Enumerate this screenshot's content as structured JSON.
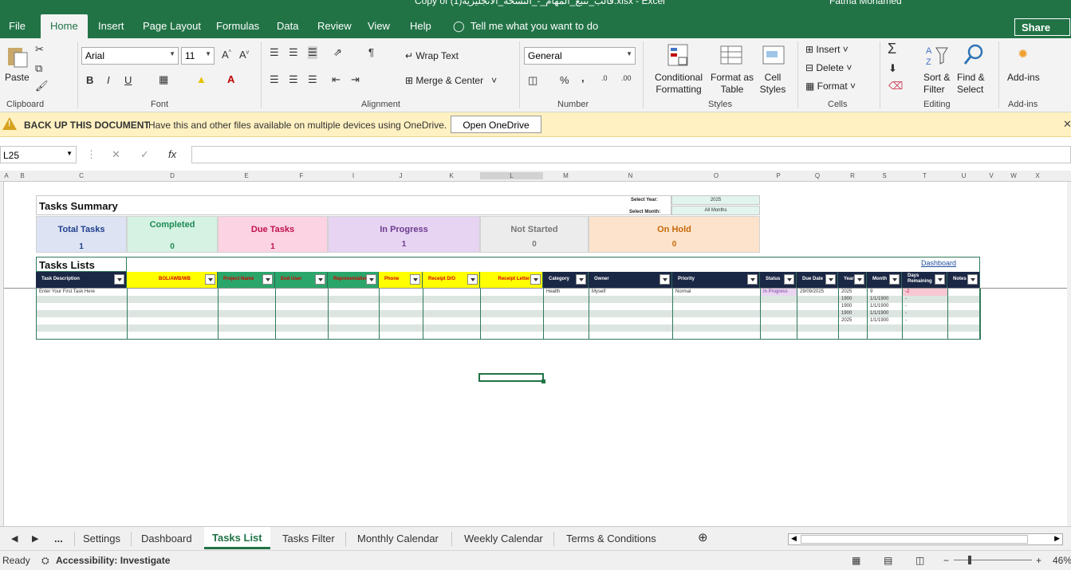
{
  "window": {
    "title": "Copy of (1)قالب_تتبع_المهام_-_النسخة_الانجليزية.xlsx  -  Excel",
    "user": "Fatma Mohamed"
  },
  "ribbon_tabs": [
    "File",
    "Home",
    "Insert",
    "Page Layout",
    "Formulas",
    "Data",
    "Review",
    "View",
    "Help"
  ],
  "tell_me": "Tell me what you want to do",
  "share": "Share",
  "ribbon": {
    "paste": "Paste",
    "font_name": "Arial",
    "font_size": "11",
    "bold": "B",
    "italic": "I",
    "underline": "U",
    "wrap_text": "Wrap Text",
    "merge_center": "Merge & Center",
    "number_format": "General",
    "percent": "%",
    "comma": ",",
    "conditional_formatting": "Conditional Formatting",
    "format_as_table": "Format as Table",
    "cell_styles": "Cell Styles",
    "insert": "Insert",
    "delete": "Delete",
    "format": "Format",
    "sort_filter": "Sort & Filter",
    "find_select": "Find & Select",
    "add_ins": "Add-ins",
    "groups": [
      "Clipboard",
      "Font",
      "Alignment",
      "Number",
      "Styles",
      "Cells",
      "Editing",
      "Add-ins"
    ]
  },
  "message_bar": {
    "title": "BACK UP THIS DOCUMENT",
    "text": "Have this and other files available on multiple devices using OneDrive.",
    "button": "Open OneDrive"
  },
  "formula_bar": {
    "name_box": "L25",
    "fx": "fx",
    "value": ""
  },
  "columns": [
    "A",
    "B",
    "C",
    "D",
    "E",
    "F",
    "I",
    "J",
    "K",
    "L",
    "M",
    "N",
    "O",
    "P",
    "Q",
    "R",
    "S",
    "T",
    "U",
    "V",
    "W",
    "X"
  ],
  "summary": {
    "title": "Tasks Summary",
    "select_year_label": "Select Year:",
    "select_year_value": "2025",
    "select_month_label": "Select Month:",
    "select_month_value": "All Months",
    "cards": [
      {
        "label": "Total Tasks",
        "value": "1",
        "bg": "#dde3f3",
        "fg": "#1f3f8c"
      },
      {
        "label": "Completed",
        "value": "0",
        "bg": "#d5f2e3",
        "fg": "#1d8a52"
      },
      {
        "label": "Due Tasks",
        "value": "1",
        "bg": "#fbd3e3",
        "fg": "#c0114f"
      },
      {
        "label": "In Progress",
        "value": "1",
        "bg": "#e6d4f2",
        "fg": "#6d3a8f"
      },
      {
        "label": "Not Started",
        "value": "0",
        "bg": "#ececec",
        "fg": "#777777"
      },
      {
        "label": "On Hold",
        "value": "0",
        "bg": "#fde3cc",
        "fg": "#c56a0a"
      }
    ]
  },
  "tasks": {
    "title": "Tasks Lists",
    "dashboard_link": "Dashboard",
    "headers": [
      "Task Description",
      "BOL/AWB/WB",
      "Project Name",
      "End User",
      "Representative",
      "Phone",
      "Receipt D/O",
      "Receipt Letter",
      "Category",
      "Owner",
      "Priority",
      "Status",
      "Due Date",
      "Year",
      "Month",
      "Days Remaining",
      "Notes"
    ],
    "rows": [
      [
        "Enter Your First Task Here",
        "",
        "",
        "",
        "",
        "",
        "",
        "",
        "Health",
        "Myself",
        "Normal",
        "In Progress",
        "29/09/2025",
        "2025",
        "9",
        "-2",
        ""
      ],
      [
        "",
        "",
        "",
        "",
        "",
        "",
        "",
        "",
        "",
        "",
        "",
        "",
        "",
        "1900",
        "1/1/1900",
        "-",
        ""
      ],
      [
        "",
        "",
        "",
        "",
        "",
        "",
        "",
        "",
        "",
        "",
        "",
        "",
        "",
        "1900",
        "1/1/1900",
        "-",
        ""
      ],
      [
        "",
        "",
        "",
        "",
        "",
        "",
        "",
        "",
        "",
        "",
        "",
        "",
        "",
        "1900",
        "1/1/1900",
        "-",
        ""
      ],
      [
        "",
        "",
        "",
        "",
        "",
        "",
        "",
        "",
        "",
        "",
        "",
        "",
        "",
        "2025",
        "1/1/1900",
        "-",
        ""
      ],
      [
        "",
        "",
        "",
        "",
        "",
        "",
        "",
        "",
        "",
        "",
        "",
        "",
        "",
        "",
        "",
        "",
        ""
      ],
      [
        "",
        "",
        "",
        "",
        "",
        "",
        "",
        "",
        "",
        "",
        "",
        "",
        "",
        "",
        "",
        "",
        ""
      ]
    ]
  },
  "sheet_tabs": [
    "...",
    "Settings",
    "Dashboard",
    "Tasks List",
    "Tasks Filter",
    "Monthly Calendar",
    "Weekly Calendar",
    "Terms & Conditions"
  ],
  "active_sheet": "Tasks List",
  "status": {
    "ready": "Ready",
    "accessibility": "Accessibility: Investigate",
    "zoom": "46%"
  }
}
